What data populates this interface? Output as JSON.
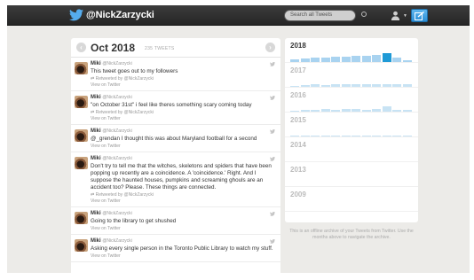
{
  "header": {
    "handle": "@NickZarzycki",
    "search_placeholder": "Search all Tweets"
  },
  "month": {
    "title": "Oct 2018",
    "count": "235 TWEETS"
  },
  "tweets": [
    {
      "name": "Miki",
      "username": "@NickZarzycki",
      "text": "This tweet goes out to my followers",
      "retweet": "Retweeted by @NickZarzycki",
      "view": "View on Twitter"
    },
    {
      "name": "Miki",
      "username": "@NickZarzycki",
      "text": "\"on October 31st\" i feel like theres something scary coming today",
      "retweet": "Retweeted by @NickZarzycki",
      "view": "View on Twitter"
    },
    {
      "name": "Miki",
      "username": "@NickZarzycki",
      "text": "@_grendan I thought this was about Maryland football for a second",
      "retweet": "",
      "view": "View on Twitter"
    },
    {
      "name": "Miki",
      "username": "@NickZarzycki",
      "text": "Don't try to tell me that the witches, skeletons and spiders that have been popping up recently are a coincidence. A 'coincidence.' Right. And I suppose the haunted houses, pumpkins and screaming ghouls are an accident too? Please. These things are connected.",
      "retweet": "Retweeted by @NickZarzycki",
      "view": "View on Twitter"
    },
    {
      "name": "Miki",
      "username": "@NickZarzycki",
      "text": "Going to the library to get shushed",
      "retweet": "",
      "view": "View on Twitter"
    },
    {
      "name": "Miki",
      "username": "@NickZarzycki",
      "text": "Asking every single person in the Toronto Public Library to watch my stuff.",
      "retweet": "",
      "view": "View on Twitter"
    }
  ],
  "archive": {
    "years": [
      {
        "label": "2018",
        "active": true,
        "months": [
          0.3,
          0.4,
          0.5,
          0.5,
          0.6,
          0.6,
          0.7,
          0.7,
          0.8,
          1.0,
          0.5,
          0.2
        ]
      },
      {
        "label": "2017",
        "active": false,
        "months": [
          0.1,
          0.2,
          0.3,
          0.25,
          0.3,
          0.3,
          0.35,
          0.3,
          0.3,
          0.35,
          0.3,
          0.3
        ]
      },
      {
        "label": "2016",
        "active": false,
        "months": [
          0.15,
          0.2,
          0.25,
          0.3,
          0.25,
          0.3,
          0.3,
          0.25,
          0.35,
          0.6,
          0.25,
          0.2
        ]
      },
      {
        "label": "2015",
        "active": false,
        "months": [
          0.1,
          0.1,
          0.15,
          0.1,
          0.1,
          0.15,
          0.15,
          0.1,
          0.1,
          0.15,
          0.1,
          0.1
        ]
      },
      {
        "label": "2014",
        "active": false,
        "months": [
          0,
          0,
          0,
          0,
          0,
          0,
          0,
          0,
          0,
          0,
          0,
          0
        ]
      },
      {
        "label": "2013",
        "active": false,
        "months": [
          0,
          0,
          0,
          0,
          0,
          0,
          0,
          0,
          0,
          0,
          0,
          0
        ]
      },
      {
        "label": "2009",
        "active": false,
        "months": [
          0,
          0,
          0,
          0,
          0,
          0,
          0,
          0,
          0,
          0,
          0,
          0
        ]
      }
    ],
    "selected_year": "2018",
    "selected_month_index": 9,
    "note": "This is an offline archive of your Tweets from Twitter. Use the months above to navigate the archive."
  },
  "colors": {
    "topbar": "#2b2b2b",
    "accent": "#1f9ad6",
    "background": "#ecebe8"
  },
  "icons": [
    "twitter-bird-icon",
    "search-icon",
    "person-icon",
    "compose-icon",
    "chevron-left-icon",
    "chevron-right-icon"
  ]
}
